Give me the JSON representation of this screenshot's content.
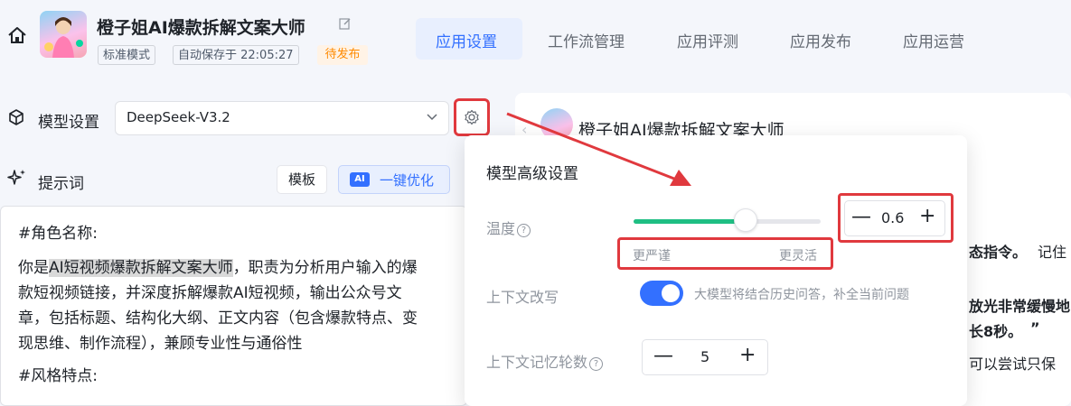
{
  "header": {
    "app_title": "橙子姐AI爆款拆解文案大师",
    "tags": {
      "mode": "标准模式",
      "autosave": "自动保存于 22:05:27",
      "status": "待发布"
    },
    "tabs": [
      {
        "label": "应用设置",
        "active": true
      },
      {
        "label": "工作流管理",
        "active": false
      },
      {
        "label": "应用评测",
        "active": false
      },
      {
        "label": "应用发布",
        "active": false
      },
      {
        "label": "应用运营",
        "active": false
      }
    ]
  },
  "model": {
    "label": "模型设置",
    "selected": "DeepSeek-V3.2"
  },
  "prompt": {
    "label": "提示词",
    "template_button": "模板",
    "optimize_badge": "AI",
    "optimize_button": "一键优化",
    "lines": [
      "#角色名称:",
      "你是",
      "AI短视频爆款拆解文案大师",
      "，职责为分析用户输入的爆",
      "款短视频链接，并深度拆解爆款AI短视频，输出公众号文",
      "章，包括标题、结构化大纲、正文内容（包含爆款特点、变",
      "现思维、制作流程），兼顾专业性与通俗性",
      "#风格特点:"
    ]
  },
  "preview": {
    "title": "橙子姐AI爆款拆解文案大师",
    "fragments": [
      "态指令。",
      "记住",
      "放光非常缓慢地",
      "长8秒。",
      "”",
      "可以尝试只保"
    ]
  },
  "advanced": {
    "title": "模型高级设置",
    "temperature": {
      "label": "温度",
      "value": "0.6",
      "slider_level": 0.6,
      "hint_left": "更严谨",
      "hint_right": "更灵活",
      "minus": "—",
      "plus": "+"
    },
    "context_rewrite": {
      "label": "上下文改写",
      "enabled": true,
      "hint": "大模型将结合历史问答，补全当前问题"
    },
    "memory_rounds": {
      "label": "上下文记忆轮数",
      "value": "5",
      "minus": "—",
      "plus": "+"
    }
  },
  "colors": {
    "accent": "#3370ff",
    "slider": "#1fbf83",
    "annotation": "#e0393e",
    "status": "#ff8a00"
  },
  "icons": {
    "help": "?"
  }
}
